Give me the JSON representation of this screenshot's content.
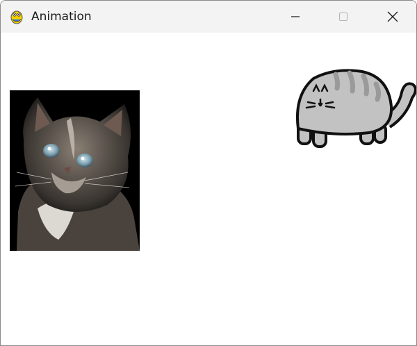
{
  "window": {
    "title": "Animation",
    "app_icon": "pygame-snake-icon",
    "controls": {
      "minimize": "minimize-icon",
      "maximize": "maximize-icon",
      "close": "close-icon"
    }
  },
  "canvas": {
    "sprites": [
      {
        "name": "kitten-photo",
        "description_icon": "kitten-photo"
      },
      {
        "name": "cartoon-cat",
        "description_icon": "cartoon-cat"
      }
    ],
    "colors": {
      "background": "#ffffff",
      "cartoon_body": "#c2c2c2",
      "cartoon_stripes": "#9a9a9a",
      "outline": "#111111"
    }
  }
}
